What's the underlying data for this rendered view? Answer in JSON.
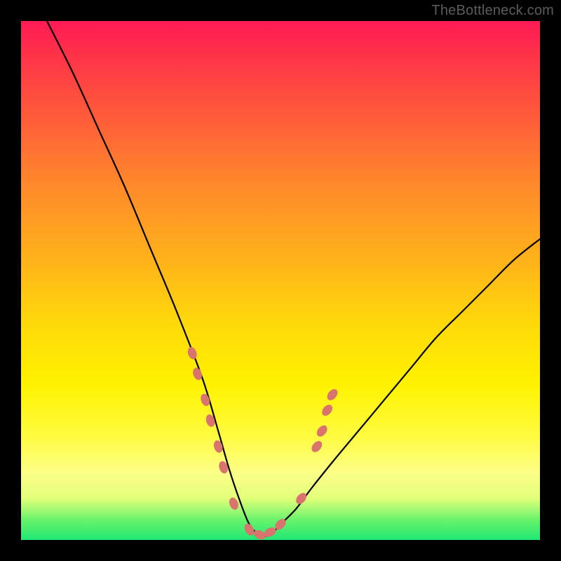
{
  "watermark": "TheBottleneck.com",
  "chart_data": {
    "type": "line",
    "title": "",
    "xlabel": "",
    "ylabel": "",
    "xlim": [
      0,
      100
    ],
    "ylim": [
      0,
      100
    ],
    "grid": false,
    "legend": false,
    "description": "Bottleneck percentage curve. The V-shaped black curve falls from ~100% at the left edge to ~0% near x≈44 (the optimal match) then rises toward ~58% at the right edge. Salmon markers highlight sampled hardware points clustered around the minimum.",
    "series": [
      {
        "name": "bottleneck-curve",
        "x": [
          5,
          10,
          15,
          20,
          25,
          30,
          35,
          38,
          40,
          42,
          44,
          46,
          48,
          50,
          53,
          56,
          60,
          65,
          70,
          75,
          80,
          85,
          90,
          95,
          100
        ],
        "y": [
          100,
          90,
          79,
          68,
          56,
          44,
          31,
          21,
          14,
          8,
          3,
          1,
          1,
          3,
          6,
          10,
          15,
          21,
          27,
          33,
          39,
          44,
          49,
          54,
          58
        ]
      }
    ],
    "markers": [
      {
        "x": 33,
        "y": 36
      },
      {
        "x": 34,
        "y": 32
      },
      {
        "x": 35.5,
        "y": 27
      },
      {
        "x": 36.5,
        "y": 23
      },
      {
        "x": 38,
        "y": 18
      },
      {
        "x": 39,
        "y": 14
      },
      {
        "x": 41,
        "y": 7
      },
      {
        "x": 44,
        "y": 2
      },
      {
        "x": 46,
        "y": 1
      },
      {
        "x": 48,
        "y": 1.5
      },
      {
        "x": 50,
        "y": 3
      },
      {
        "x": 54,
        "y": 8
      },
      {
        "x": 57,
        "y": 18
      },
      {
        "x": 58,
        "y": 21
      },
      {
        "x": 59,
        "y": 25
      },
      {
        "x": 60,
        "y": 28
      }
    ],
    "marker_color": "#d9736e",
    "curve_color": "#000000"
  }
}
